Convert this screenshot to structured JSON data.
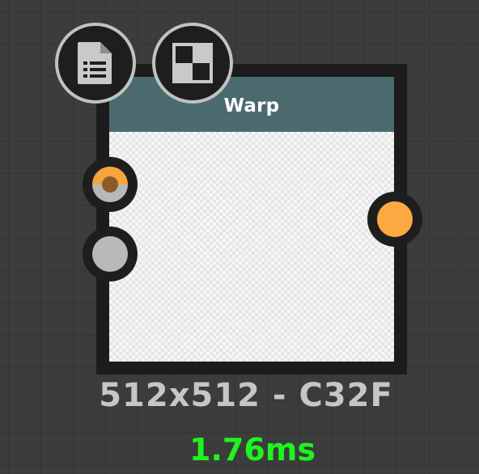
{
  "node": {
    "title": "Warp",
    "resolution_info": "512x512 - C32F",
    "timing": "1.76ms"
  },
  "buttons": {
    "documentation": {
      "icon": "document-list-icon"
    },
    "preview_toggle": {
      "icon": "checkerboard-icon"
    }
  },
  "ports": {
    "inputs": [
      {
        "icon": "input-port-half-orange-gray",
        "colors": [
          "#f7a43e",
          "#b8b8b8"
        ]
      },
      {
        "icon": "input-port-gray",
        "color": "#b9b9b9"
      }
    ],
    "outputs": [
      {
        "icon": "output-port-orange",
        "color": "#fca941"
      }
    ]
  },
  "colors": {
    "canvas": "#3c3c3c",
    "node_frame": "#1c1c1c",
    "header": "#4a6a6e",
    "info_text": "#c6c6c6",
    "timing_text": "#1ef51e",
    "port_orange": "#fca941",
    "port_gray": "#b9b9b9"
  }
}
